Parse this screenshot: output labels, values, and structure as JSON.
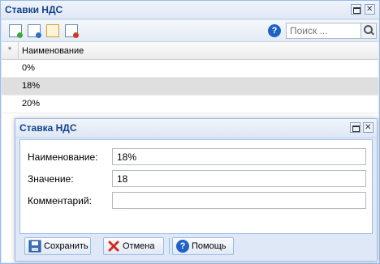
{
  "main_window": {
    "title": "Ставки НДС",
    "search": {
      "placeholder": "Поиск ..."
    },
    "grid": {
      "columns": [
        "*",
        "Наименование"
      ],
      "rows": [
        {
          "name": "0%"
        },
        {
          "name": "18%"
        },
        {
          "name": "20%"
        }
      ],
      "selected_index": 1
    },
    "toolbar_icons": [
      "add-icon",
      "edit-icon",
      "copy-icon",
      "delete-icon"
    ]
  },
  "dialog": {
    "title": "Ставка НДС",
    "fields": {
      "name": {
        "label": "Наименование:",
        "value": "18%"
      },
      "value": {
        "label": "Значение:",
        "value": "18"
      },
      "comment": {
        "label": "Комментарий:",
        "value": ""
      }
    },
    "buttons": {
      "save": "Сохранить",
      "cancel": "Отмена",
      "help": "Помощь"
    }
  },
  "colors": {
    "border": "#99bbe8",
    "panel": "#dfe8f6",
    "title": "#15428b",
    "selected_row": "#dfdfdf"
  }
}
